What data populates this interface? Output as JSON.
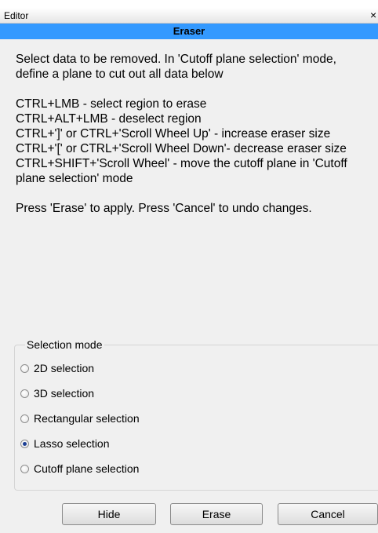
{
  "window": {
    "title": "Editor",
    "close_glyph": "×"
  },
  "panel": {
    "header": "Eraser"
  },
  "instructions": {
    "intro": "Select data to be removed. In 'Cutoff plane selection' mode, define a plane to cut out all data below",
    "shortcuts": [
      "CTRL+LMB - select region to erase",
      "CTRL+ALT+LMB - deselect region",
      "CTRL+']' or CTRL+'Scroll Wheel Up' - increase eraser size",
      "CTRL+'[' or CTRL+'Scroll Wheel Down'- decrease eraser size",
      "CTRL+SHIFT+'Scroll Wheel' - move the cutoff plane in 'Cutoff plane selection' mode"
    ],
    "footer": "Press 'Erase' to apply. Press 'Cancel' to undo changes."
  },
  "selection_mode": {
    "label": "Selection mode",
    "options": [
      {
        "label": "2D selection",
        "checked": false
      },
      {
        "label": "3D selection",
        "checked": false
      },
      {
        "label": "Rectangular selection",
        "checked": false
      },
      {
        "label": "Lasso selection",
        "checked": true
      },
      {
        "label": "Cutoff plane selection",
        "checked": false
      }
    ]
  },
  "buttons": {
    "hide": "Hide",
    "erase": "Erase",
    "cancel": "Cancel"
  },
  "colors": {
    "header_bg": "#3399ff",
    "window_bg": "#f0f0f0"
  }
}
